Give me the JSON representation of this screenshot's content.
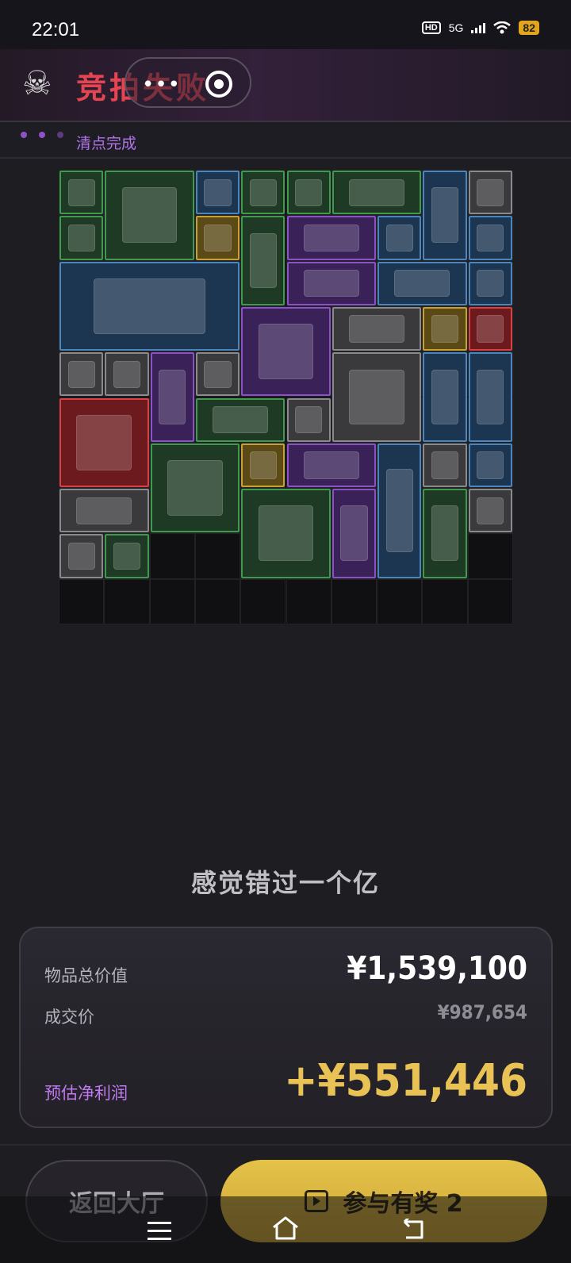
{
  "status": {
    "time": "22:01",
    "hd": "HD",
    "network": "5G",
    "battery": "82"
  },
  "header": {
    "title": "竞拍失败",
    "skull_icon": "☠"
  },
  "progress": {
    "label": "清点完成"
  },
  "grid": {
    "cols": 10,
    "rows": 10,
    "rarity_colors": {
      "green": "#3f9a4d",
      "blue": "#4a86bd",
      "purple": "#8a52c6",
      "gold": "#c7a133",
      "red": "#d94046",
      "white": "#8a8a8c"
    },
    "items": [
      {
        "name": "pressure-gauge",
        "rarity": "g"
      },
      {
        "name": "tropical-painting",
        "rarity": "g"
      },
      {
        "name": "ancient-coin",
        "rarity": "b"
      },
      {
        "name": "circuit-chip",
        "rarity": "g"
      },
      {
        "name": "lighter",
        "rarity": "g"
      },
      {
        "name": "old-document",
        "rarity": "g"
      },
      {
        "name": "stethoscope",
        "rarity": "b"
      },
      {
        "name": "computer-mouse",
        "rarity": "w"
      },
      {
        "name": "tweezers",
        "rarity": "g"
      },
      {
        "name": "crystal-trophy",
        "rarity": "y"
      },
      {
        "name": "djembe-drum",
        "rarity": "g"
      },
      {
        "name": "graphics-card",
        "rarity": "p"
      },
      {
        "name": "ssd-drive",
        "rarity": "b"
      },
      {
        "name": "cpu-cooler",
        "rarity": "b"
      },
      {
        "name": "solar-panel",
        "rarity": "b"
      },
      {
        "name": "camera-lens",
        "rarity": "p"
      },
      {
        "name": "rifle-part",
        "rarity": "b"
      },
      {
        "name": "id-card",
        "rarity": "b"
      },
      {
        "name": "circular-saw",
        "rarity": "p"
      },
      {
        "name": "vintage-photo",
        "rarity": "w"
      },
      {
        "name": "ram-stick",
        "rarity": "y"
      },
      {
        "name": "jewel-box",
        "rarity": "r"
      },
      {
        "name": "playing-card",
        "rarity": "w"
      },
      {
        "name": "playing-card",
        "rarity": "w"
      },
      {
        "name": "hookah",
        "rarity": "p"
      },
      {
        "name": "document-stack",
        "rarity": "w"
      },
      {
        "name": "candle-box",
        "rarity": "w"
      },
      {
        "name": "moka-pot",
        "rarity": "b"
      },
      {
        "name": "telescope",
        "rarity": "b"
      },
      {
        "name": "drone",
        "rarity": "r"
      },
      {
        "name": "wooden-plank",
        "rarity": "g"
      },
      {
        "name": "playing-card",
        "rarity": "w"
      },
      {
        "name": "spice-rack",
        "rarity": "g"
      },
      {
        "name": "medal",
        "rarity": "y"
      },
      {
        "name": "graphics-card",
        "rarity": "p"
      },
      {
        "name": "atm-kiosk",
        "rarity": "b"
      },
      {
        "name": "computer-mouse",
        "rarity": "w"
      },
      {
        "name": "ancient-coin",
        "rarity": "b"
      },
      {
        "name": "vintage-photo",
        "rarity": "w"
      },
      {
        "name": "sphinx-statue",
        "rarity": "g"
      },
      {
        "name": "old-book",
        "rarity": "p"
      },
      {
        "name": "tribal-statue",
        "rarity": "g"
      },
      {
        "name": "document-stack",
        "rarity": "w"
      },
      {
        "name": "protein-tin",
        "rarity": "w"
      },
      {
        "name": "toy-boat",
        "rarity": "g"
      }
    ]
  },
  "tagline": "感觉错过一个亿",
  "summary": {
    "total_label": "物品总价值",
    "total_value": "¥1,539,100",
    "deal_label": "成交价",
    "deal_value": "¥987,654",
    "profit_label": "预估净利润",
    "profit_value": "+¥551,446"
  },
  "buttons": {
    "back": "返回大厅",
    "join": "参与有奖 2"
  }
}
